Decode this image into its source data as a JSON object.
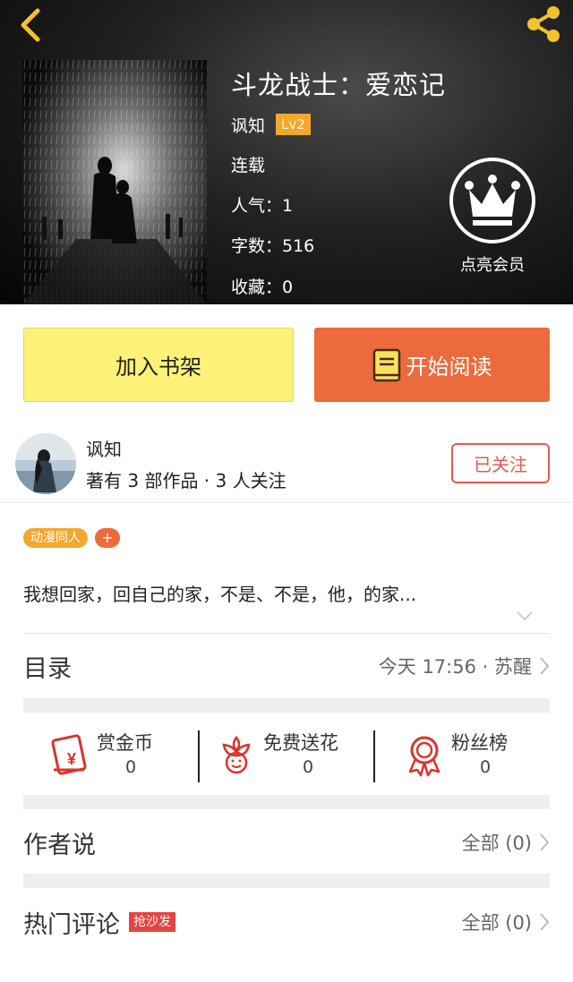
{
  "header": {
    "back_icon": "chevron-left-icon",
    "share_icon": "share-icon",
    "accent_color": "#f3c22b"
  },
  "book": {
    "title": "斗龙战士：爱恋记",
    "author": "讽知",
    "level": "Lv2",
    "status": "连载",
    "popularity": "人气：1",
    "word_count": "字数：516",
    "favorites": "收藏：0"
  },
  "vip": {
    "icon": "crown-icon",
    "label": "点亮会员"
  },
  "actions": {
    "add_shelf": "加入书架",
    "start_read": "开始阅读"
  },
  "author_info": {
    "name": "讽知",
    "works": "著有 3 部作品 · 3 人关注",
    "follow_label": "已关注"
  },
  "tags": {
    "items": [
      "动漫同人"
    ],
    "add": "+"
  },
  "synopsis": "我想回家，回自己的家，不是、不是，他，的家...",
  "catalog": {
    "title": "目录",
    "latest": "今天 17:56 · 苏醒"
  },
  "stats": [
    {
      "icon": "red-envelope-icon",
      "label": "赏金币",
      "value": "0"
    },
    {
      "icon": "flower-icon",
      "label": "免费送花",
      "value": "0"
    },
    {
      "icon": "award-ribbon-icon",
      "label": "粉丝榜",
      "value": "0"
    }
  ],
  "author_says": {
    "title": "作者说",
    "all": "全部 (0)"
  },
  "hot_comments": {
    "title": "热门评论",
    "badge": "抢沙发",
    "all": "全部 (0)"
  },
  "colors": {
    "shelf_button": "#fbf277",
    "read_button": "#ec6a3b",
    "tag": "#f3a72c",
    "follow": "#e65a4e",
    "stat_icon": "#d9342b"
  }
}
